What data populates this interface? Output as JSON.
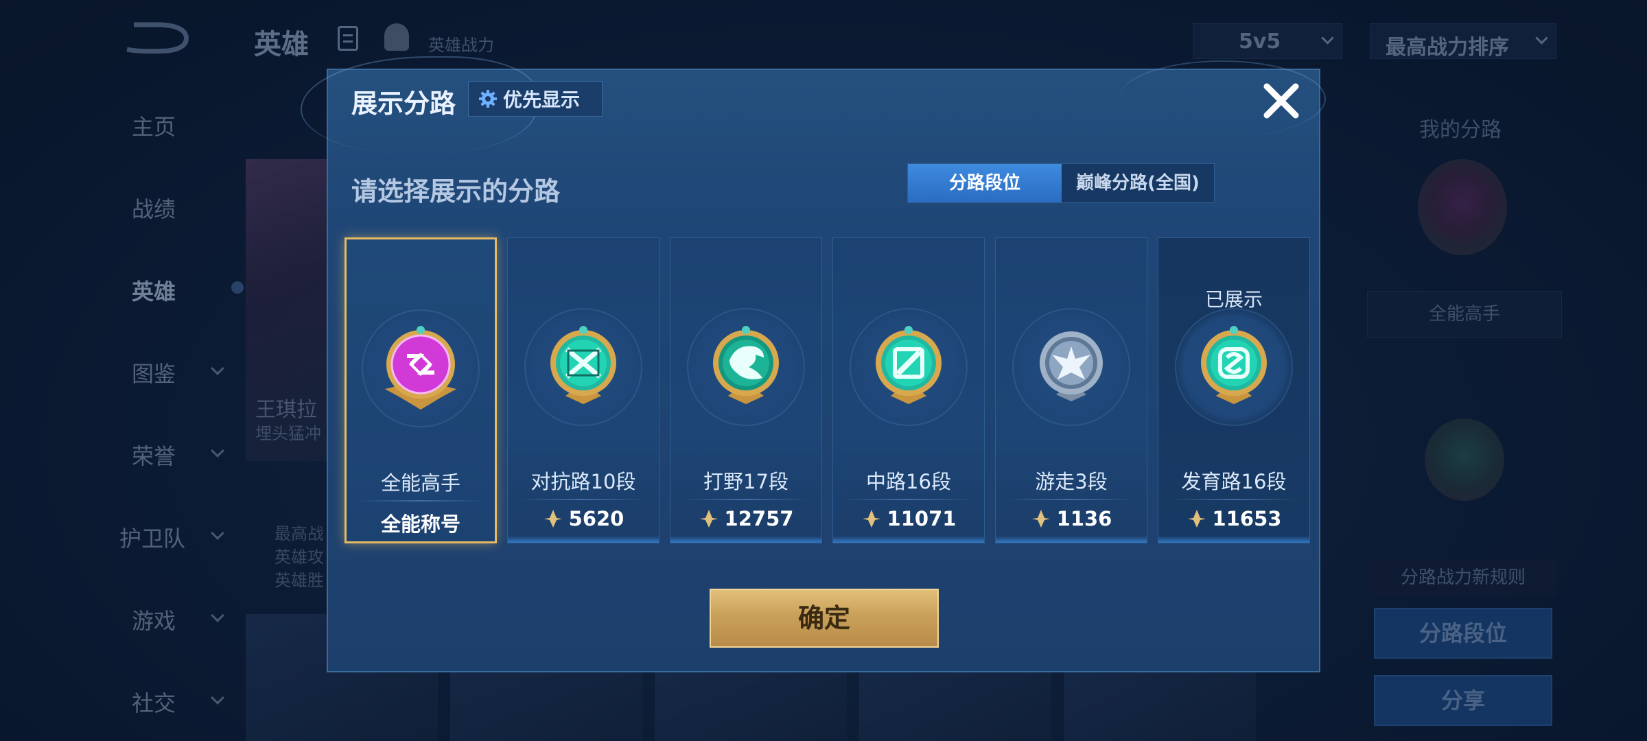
{
  "background": {
    "top_title": "英雄",
    "hero_power_label": "英雄战力",
    "mode_select": "5v5",
    "sort_select": "最高战力排序",
    "nav": [
      "主页",
      "战绩",
      "英雄",
      "图鉴",
      "荣誉",
      "护卫队",
      "游戏",
      "社交"
    ],
    "active_nav": "英雄",
    "hero_name": "王琪拉",
    "hero_sub": "埋头猛冲",
    "stat_lines": [
      "最高战",
      "英雄攻",
      "英雄胜"
    ],
    "my_route_title": "我的分路",
    "my_route_label": "全能高手",
    "rules_label": "分路战力新规则",
    "btn_route_rank": "分路段位",
    "btn_share": "分享"
  },
  "modal": {
    "title": "展示分路",
    "priority_button": "优先显示",
    "subtitle": "请选择展示的分路",
    "tabs": [
      {
        "label": "分路段位",
        "active": true
      },
      {
        "label": "巅峰分路(全国)",
        "active": false
      }
    ],
    "cards": [
      {
        "name": "全能高手",
        "value": "全能称号",
        "icon": "all-round-badge-icon",
        "selected": true,
        "shown": false
      },
      {
        "name": "对抗路10段",
        "value": "5620",
        "icon": "clash-lane-badge-icon",
        "selected": false,
        "shown": false
      },
      {
        "name": "打野17段",
        "value": "12757",
        "icon": "jungle-badge-icon",
        "selected": false,
        "shown": false
      },
      {
        "name": "中路16段",
        "value": "11071",
        "icon": "mid-lane-badge-icon",
        "selected": false,
        "shown": false
      },
      {
        "name": "游走3段",
        "value": "1136",
        "icon": "roam-badge-icon",
        "selected": false,
        "shown": false
      },
      {
        "name": "发育路16段",
        "value": "11653",
        "icon": "farm-lane-badge-icon",
        "selected": false,
        "shown": true
      }
    ],
    "shown_tag": "已展示",
    "confirm_button": "确定"
  },
  "colors": {
    "gold": "#e6b963",
    "accent_blue": "#3e8be0",
    "modal_bg": "#1f4777",
    "teal_badge": "#1fd3b0",
    "magenta_badge": "#d23ad8"
  }
}
